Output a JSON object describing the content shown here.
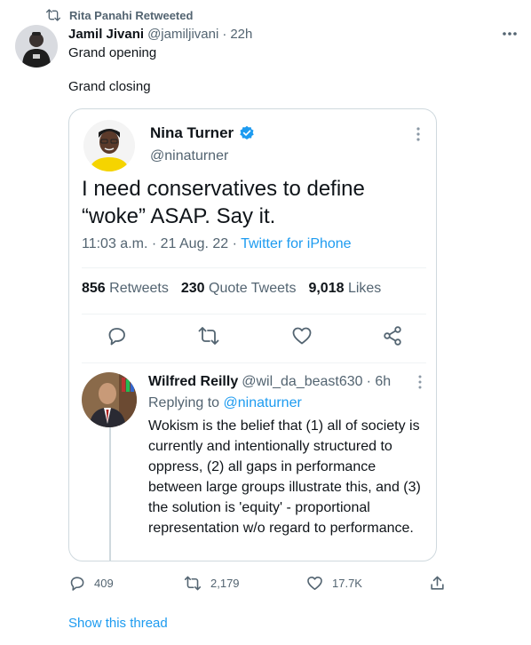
{
  "retweet_banner": {
    "icon": "retweet-icon",
    "text": "Rita Panahi Retweeted"
  },
  "tweet": {
    "author_name": "Jamil Jivani",
    "author_handle": "@jamiljivani",
    "separator": "·",
    "time": "22h",
    "text": "Grand opening\n\nGrand closing",
    "more_icon": "more-horizontal-icon"
  },
  "quote": {
    "author_name": "Nina Turner",
    "verified": true,
    "author_handle": "@ninaturner",
    "text": "I need conservatives to define “woke” ASAP. Say it.",
    "time": "11:03 a.m. · 21 Aug. 22 · ",
    "source": "Twitter for iPhone",
    "stats": {
      "retweets_count": "856",
      "retweets_label": "Retweets",
      "quotes_count": "230",
      "quotes_label": "Quote Tweets",
      "likes_count": "9,018",
      "likes_label": "Likes"
    },
    "actions": [
      "reply-icon",
      "retweet-icon",
      "like-icon",
      "share-icon"
    ],
    "reply": {
      "author_name": "Wilfred Reilly",
      "author_handle": "@wil_da_beast630",
      "time": "· 6h",
      "replying_prefix": "Replying to ",
      "replying_to": "@ninaturner",
      "text": "Wokism is the belief that (1) all of society is currently and intentionally structured to oppress, (2) all gaps in performance between large groups illustrate this, and (3) the solution is 'equity' - proportional representation w/o regard to performance."
    }
  },
  "actions": {
    "replies": "409",
    "retweets": "2,179",
    "likes": "17.7K"
  },
  "show_thread": "Show this thread",
  "colors": {
    "accent": "#1d9bf0",
    "muted": "#536471",
    "text": "#0f1419",
    "border": "#cfd9de"
  }
}
